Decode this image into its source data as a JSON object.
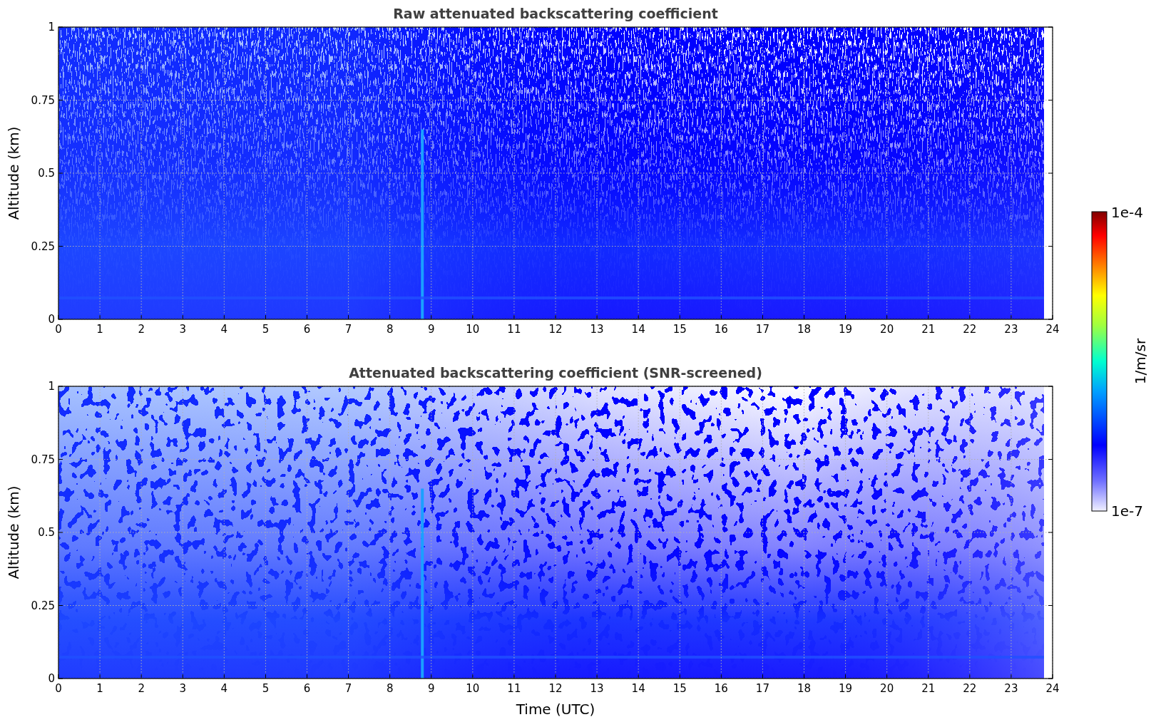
{
  "panels": [
    {
      "kind": "raw",
      "title": "Raw attenuated backscattering coefficient",
      "y_label": "Altitude (km)",
      "y_ticks": [
        "1",
        "0.75",
        "0.5",
        "0.25",
        "0"
      ],
      "x_ticks": [
        "0",
        "1",
        "2",
        "3",
        "4",
        "5",
        "6",
        "7",
        "8",
        "9",
        "10",
        "11",
        "12",
        "13",
        "14",
        "15",
        "16",
        "17",
        "18",
        "19",
        "20",
        "21",
        "22",
        "23",
        "24"
      ]
    },
    {
      "kind": "screened",
      "title": "Attenuated backscattering coefficient (SNR-screened)",
      "y_label": "Altitude (km)",
      "y_ticks": [
        "1",
        "0.75",
        "0.5",
        "0.25",
        "0"
      ],
      "x_ticks": [
        "0",
        "1",
        "2",
        "3",
        "4",
        "5",
        "6",
        "7",
        "8",
        "9",
        "10",
        "11",
        "12",
        "13",
        "14",
        "15",
        "16",
        "17",
        "18",
        "19",
        "20",
        "21",
        "22",
        "23",
        "24"
      ],
      "x_label": "Time (UTC)"
    }
  ],
  "colorbar": {
    "max_label": "1e-4",
    "min_label": "1e-7",
    "label": "1/m/sr"
  }
}
